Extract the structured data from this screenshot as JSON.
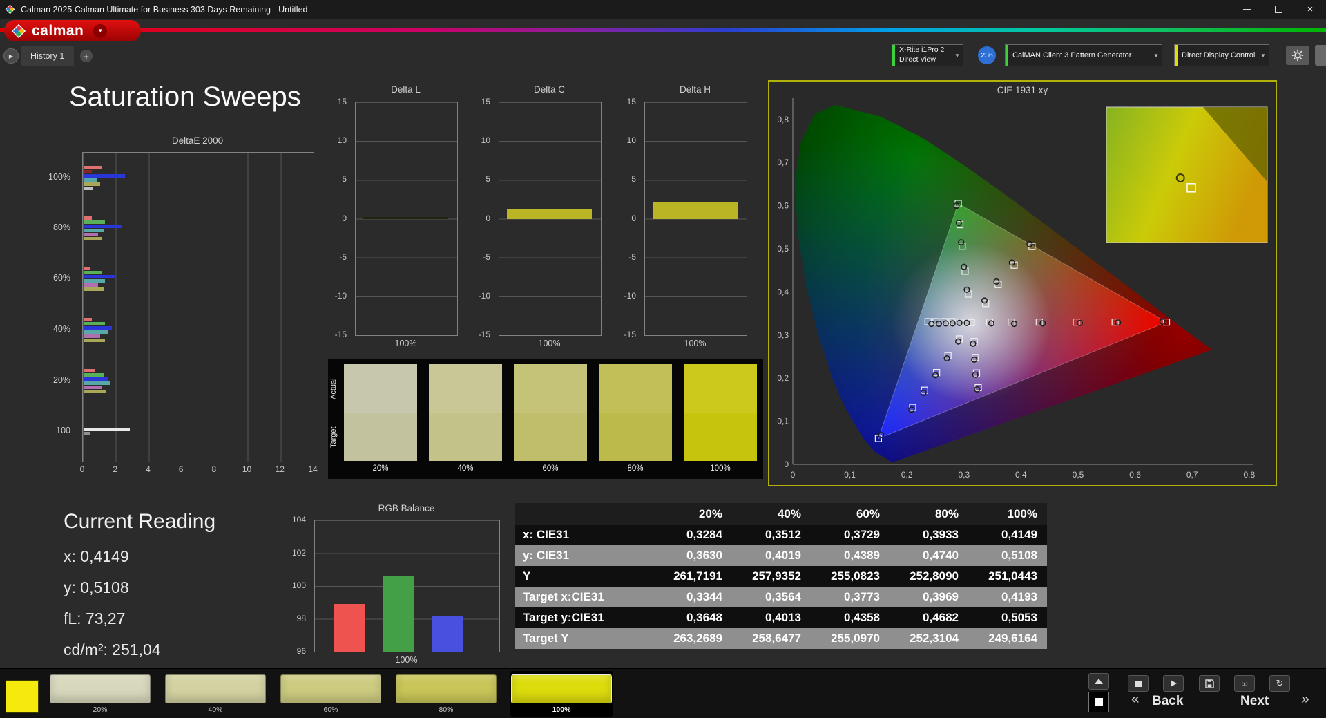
{
  "window": {
    "title": "Calman 2025 Calman Ultimate for Business 303 Days Remaining - Untitled"
  },
  "brand": {
    "logo_text": "calman"
  },
  "tab_bar": {
    "history_tab": "History 1"
  },
  "toolbar": {
    "meter_line1": "X-Rite i1Pro 2",
    "meter_line2": "Direct View",
    "meter_badge": "236",
    "pattern_generator": "CalMAN Client 3 Pattern Generator",
    "display_control": "Direct Display Control"
  },
  "icons": {
    "dropdown_arrow": "▼",
    "play": "▶",
    "plus": "+",
    "minimize": "–",
    "close": "×",
    "link": "∞",
    "refresh": "↻",
    "back_fast": "«",
    "next_fast": "»"
  },
  "page_title": "Saturation Sweeps",
  "swatch_panel": {
    "row_labels": [
      "Actual",
      "Target"
    ],
    "items": [
      {
        "label": "20%",
        "actual": "#c7c7ad",
        "target": "#c2c29f"
      },
      {
        "label": "40%",
        "actual": "#c8c795",
        "target": "#c3c289"
      },
      {
        "label": "60%",
        "actual": "#c5c377",
        "target": "#c0be6a"
      },
      {
        "label": "80%",
        "actual": "#c2bf58",
        "target": "#bdba4c"
      },
      {
        "label": "100%",
        "actual": "#ccc91c",
        "target": "#c7c40e"
      }
    ]
  },
  "current_reading": {
    "title": "Current Reading",
    "lines": [
      "x: 0,4149",
      "y: 0,5108",
      "fL: 73,27",
      "cd/m²: 251,04"
    ]
  },
  "table": {
    "headers": [
      "20%",
      "40%",
      "60%",
      "80%",
      "100%"
    ],
    "rows": [
      {
        "label": "x: CIE31",
        "shade": "dark",
        "values": [
          "0,3284",
          "0,3512",
          "0,3729",
          "0,3933",
          "0,4149"
        ]
      },
      {
        "label": "y: CIE31",
        "shade": "gray",
        "values": [
          "0,3630",
          "0,4019",
          "0,4389",
          "0,4740",
          "0,5108"
        ]
      },
      {
        "label": "Y",
        "shade": "dark",
        "values": [
          "261,7191",
          "257,9352",
          "255,0823",
          "252,8090",
          "251,0443"
        ]
      },
      {
        "label": "Target x:CIE31",
        "shade": "gray",
        "values": [
          "0,3344",
          "0,3564",
          "0,3773",
          "0,3969",
          "0,4193"
        ]
      },
      {
        "label": "Target y:CIE31",
        "shade": "dark",
        "values": [
          "0,3648",
          "0,4013",
          "0,4358",
          "0,4682",
          "0,5053"
        ]
      },
      {
        "label": "Target Y",
        "shade": "gray",
        "values": [
          "263,2689",
          "258,6477",
          "255,0970",
          "252,3104",
          "249,6164"
        ]
      }
    ]
  },
  "bottom_bar": {
    "current_color": "#f6ea0c",
    "swatches": [
      {
        "label": "20%",
        "color": "#d8d8bd"
      },
      {
        "label": "40%",
        "color": "#d3d2a2"
      },
      {
        "label": "60%",
        "color": "#cccb80"
      },
      {
        "label": "80%",
        "color": "#c9c558"
      },
      {
        "label": "100%",
        "color": "#dcdc0c",
        "selected": true
      }
    ],
    "back_label": "Back",
    "next_label": "Next"
  },
  "chart_data": [
    {
      "type": "bar",
      "title": "DeltaE 2000",
      "orientation": "horizontal",
      "xlim": [
        0,
        14
      ],
      "xticks": [
        "0",
        "2",
        "4",
        "6",
        "8",
        "10",
        "12",
        "14"
      ],
      "groups": [
        {
          "label": "100%",
          "bars": [
            {
              "v": 1.1,
              "c": "#e07070"
            },
            {
              "v": 0.5,
              "c": "#8a2525"
            },
            {
              "v": 2.5,
              "c": "#2b36d9"
            },
            {
              "v": 0.8,
              "c": "#58a8a8"
            },
            {
              "v": 1.0,
              "c": "#a8a858"
            },
            {
              "v": 0.6,
              "c": "#c0c0c0"
            }
          ]
        },
        {
          "label": "80%",
          "bars": [
            {
              "v": 0.5,
              "c": "#e07070"
            },
            {
              "v": 1.3,
              "c": "#58b058"
            },
            {
              "v": 2.3,
              "c": "#2b36d9"
            },
            {
              "v": 1.2,
              "c": "#58a8a8"
            },
            {
              "v": 0.9,
              "c": "#b070b0"
            },
            {
              "v": 1.1,
              "c": "#a8a858"
            }
          ]
        },
        {
          "label": "60%",
          "bars": [
            {
              "v": 0.4,
              "c": "#e07070"
            },
            {
              "v": 1.1,
              "c": "#58b058"
            },
            {
              "v": 1.9,
              "c": "#2b36d9"
            },
            {
              "v": 1.3,
              "c": "#58a8a8"
            },
            {
              "v": 0.9,
              "c": "#b070b0"
            },
            {
              "v": 1.2,
              "c": "#a8a858"
            }
          ]
        },
        {
          "label": "40%",
          "bars": [
            {
              "v": 0.5,
              "c": "#e07070"
            },
            {
              "v": 1.3,
              "c": "#58b058"
            },
            {
              "v": 1.7,
              "c": "#2b36d9"
            },
            {
              "v": 1.5,
              "c": "#58a8a8"
            },
            {
              "v": 1.0,
              "c": "#b070b0"
            },
            {
              "v": 1.3,
              "c": "#a8a858"
            }
          ]
        },
        {
          "label": "20%",
          "bars": [
            {
              "v": 0.7,
              "c": "#e07070"
            },
            {
              "v": 1.2,
              "c": "#58b058"
            },
            {
              "v": 1.5,
              "c": "#2b36d9"
            },
            {
              "v": 1.6,
              "c": "#58a8a8"
            },
            {
              "v": 1.1,
              "c": "#b070b0"
            },
            {
              "v": 1.4,
              "c": "#a8a858"
            }
          ]
        },
        {
          "label": "100",
          "bars": [
            {
              "v": 2.8,
              "c": "#e8e8e8"
            },
            {
              "v": 0.4,
              "c": "#909090"
            }
          ]
        }
      ]
    },
    {
      "type": "bar",
      "title": "Delta L",
      "ylim": [
        -15,
        15
      ],
      "yticks": [
        "15",
        "10",
        "5",
        "0",
        "-5",
        "-10",
        "-15"
      ],
      "xlabel": "100%",
      "values": [
        0.25
      ],
      "color": "#23230f"
    },
    {
      "type": "bar",
      "title": "Delta C",
      "ylim": [
        -15,
        15
      ],
      "yticks": [
        "15",
        "10",
        "5",
        "0",
        "-5",
        "-10",
        "-15"
      ],
      "xlabel": "100%",
      "values": [
        1.2
      ],
      "color": "#b9b525"
    },
    {
      "type": "bar",
      "title": "Delta H",
      "ylim": [
        -15,
        15
      ],
      "yticks": [
        "15",
        "10",
        "5",
        "0",
        "-5",
        "-10",
        "-15"
      ],
      "xlabel": "100%",
      "values": [
        2.2
      ],
      "color": "#b9b525"
    },
    {
      "type": "scatter",
      "title": "CIE 1931 xy",
      "xlim": [
        0,
        0.8
      ],
      "ylim": [
        0,
        0.8
      ],
      "xticks": [
        "0",
        "0,1",
        "0,2",
        "0,3",
        "0,4",
        "0,5",
        "0,6",
        "0,7",
        "0,8"
      ],
      "yticks": [
        "0,8",
        "0,7",
        "0,6",
        "0,5",
        "0,4",
        "0,3",
        "0,2",
        "0,1",
        "0"
      ],
      "gamut_triangle": [
        [
          0.655,
          0.33
        ],
        [
          0.29,
          0.605
        ],
        [
          0.15,
          0.06
        ]
      ],
      "white_point": [
        0.3127,
        0.329
      ],
      "targets": [
        [
          0.237,
          0.331
        ],
        [
          0.251,
          0.331
        ],
        [
          0.265,
          0.331
        ],
        [
          0.279,
          0.331
        ],
        [
          0.294,
          0.33
        ],
        [
          0.313,
          0.329
        ],
        [
          0.345,
          0.33
        ],
        [
          0.383,
          0.33
        ],
        [
          0.432,
          0.33
        ],
        [
          0.497,
          0.33
        ],
        [
          0.565,
          0.33
        ],
        [
          0.655,
          0.33
        ],
        [
          0.308,
          0.395
        ],
        [
          0.302,
          0.448
        ],
        [
          0.297,
          0.506
        ],
        [
          0.293,
          0.556
        ],
        [
          0.29,
          0.605
        ],
        [
          0.338,
          0.373
        ],
        [
          0.36,
          0.417
        ],
        [
          0.388,
          0.462
        ],
        [
          0.4193,
          0.5053
        ],
        [
          0.292,
          0.291
        ],
        [
          0.272,
          0.252
        ],
        [
          0.252,
          0.213
        ],
        [
          0.231,
          0.172
        ],
        [
          0.21,
          0.132
        ],
        [
          0.15,
          0.06
        ],
        [
          0.318,
          0.285
        ],
        [
          0.32,
          0.248
        ],
        [
          0.322,
          0.212
        ],
        [
          0.325,
          0.178
        ]
      ],
      "measured": [
        [
          0.243,
          0.326
        ],
        [
          0.256,
          0.326
        ],
        [
          0.268,
          0.327
        ],
        [
          0.28,
          0.327
        ],
        [
          0.292,
          0.328
        ],
        [
          0.305,
          0.328
        ],
        [
          0.348,
          0.327
        ],
        [
          0.388,
          0.326
        ],
        [
          0.438,
          0.327
        ],
        [
          0.503,
          0.328
        ],
        [
          0.57,
          0.329
        ],
        [
          0.648,
          0.331
        ],
        [
          0.305,
          0.405
        ],
        [
          0.3,
          0.458
        ],
        [
          0.295,
          0.515
        ],
        [
          0.291,
          0.56
        ],
        [
          0.287,
          0.6
        ],
        [
          0.336,
          0.38
        ],
        [
          0.357,
          0.424
        ],
        [
          0.384,
          0.468
        ],
        [
          0.4149,
          0.5108
        ],
        [
          0.29,
          0.285
        ],
        [
          0.27,
          0.246
        ],
        [
          0.25,
          0.207
        ],
        [
          0.229,
          0.166
        ],
        [
          0.208,
          0.127
        ],
        [
          0.155,
          0.068
        ],
        [
          0.316,
          0.28
        ],
        [
          0.318,
          0.243
        ],
        [
          0.32,
          0.208
        ],
        [
          0.323,
          0.174
        ]
      ],
      "inset": {
        "region": [
          0.385,
          0.475,
          0.45,
          0.55
        ],
        "measured": [
          0.4149,
          0.5108
        ],
        "target": [
          0.4193,
          0.5053
        ]
      }
    },
    {
      "type": "bar",
      "title": "RGB Balance",
      "ylim": [
        96,
        104
      ],
      "yticks": [
        "104",
        "102",
        "100",
        "98",
        "96"
      ],
      "categories": [
        "Red",
        "Green",
        "Blue"
      ],
      "values": [
        98.9,
        100.6,
        98.2
      ],
      "colors": [
        "#ef5350",
        "#43a047",
        "#4950e0"
      ],
      "xlabel": "100%"
    }
  ]
}
